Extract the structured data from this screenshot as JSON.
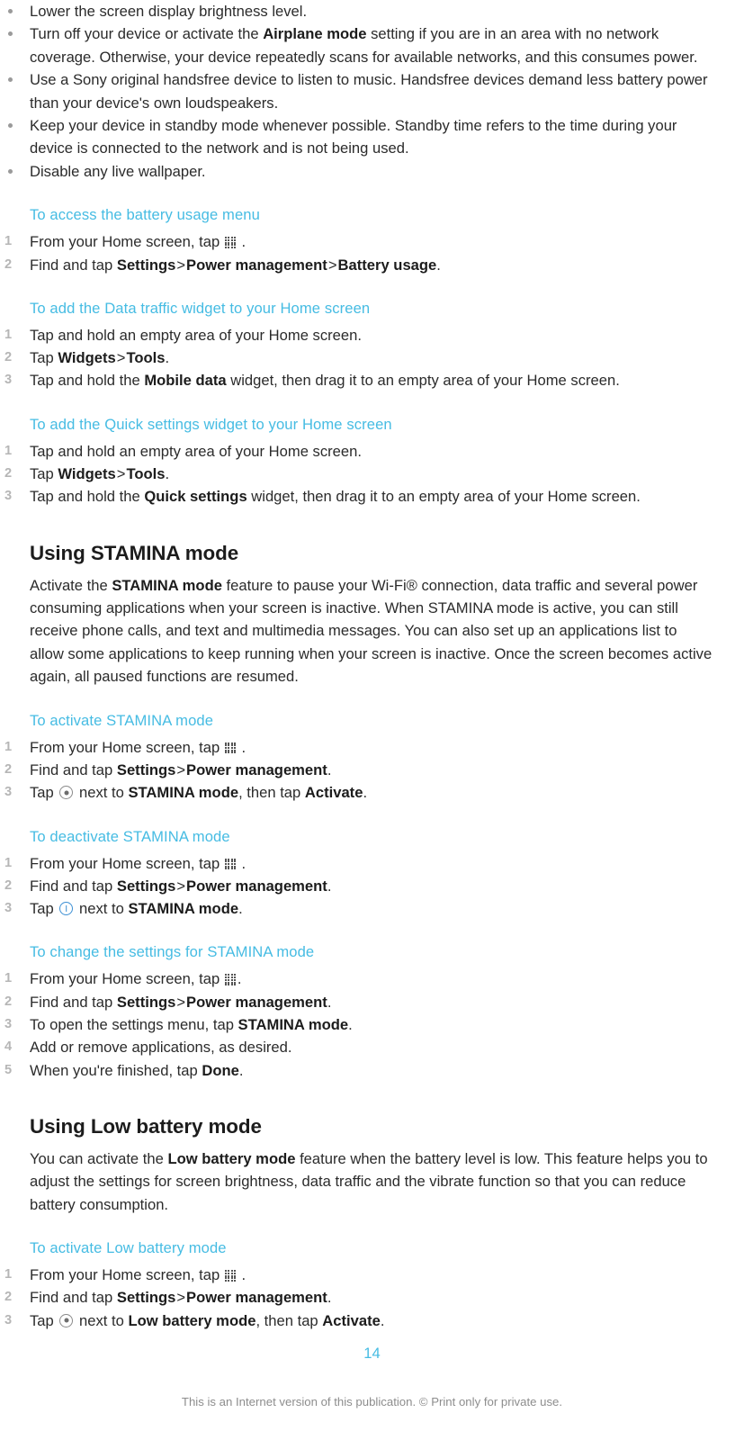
{
  "document": {
    "page_number": "14",
    "footer_note": "This is an Internet version of this publication. © Print only for private use.",
    "heading_color": "#46BCE3"
  },
  "battery_tips": {
    "items": [
      {
        "prefix": "Lower the screen display brightness level.",
        "bold": "",
        "suffix": ""
      },
      {
        "prefix": "Turn off your device or activate the ",
        "bold": "Airplane mode",
        "suffix": " setting if you are in an area with no network coverage. Otherwise, your device repeatedly scans for available networks, and this consumes power."
      },
      {
        "prefix": "Use a Sony original handsfree device to listen to music. Handsfree devices demand less battery power than your device's own loudspeakers.",
        "bold": "",
        "suffix": ""
      },
      {
        "prefix": "Keep your device in standby mode whenever possible. Standby time refers to the time during your device is connected to the network and is not being used.",
        "bold": "",
        "suffix": ""
      },
      {
        "prefix": "Disable any live wallpaper.",
        "bold": "",
        "suffix": ""
      }
    ]
  },
  "proc_battery_usage": {
    "heading": "To access the battery usage menu",
    "step1_before": "From your Home screen, tap",
    "step1_after": ".",
    "step2_a": "Find and tap ",
    "step2_b": "Settings",
    "step2_gt1": ">",
    "step2_c": "Power management",
    "step2_gt2": ">",
    "step2_d": "Battery usage",
    "step2_e": "."
  },
  "proc_data_widget": {
    "heading": "To add the Data traffic widget to your Home screen",
    "step1": "Tap and hold an empty area of your Home screen.",
    "step2_a": "Tap ",
    "step2_b": "Widgets",
    "step2_gt": ">",
    "step2_c": "Tools",
    "step2_d": ".",
    "step3_a": "Tap and hold the ",
    "step3_b": "Mobile data",
    "step3_c": " widget, then drag it to an empty area of your Home screen."
  },
  "proc_quick_settings_widget": {
    "heading": "To add the Quick settings widget to your Home screen",
    "step1": "Tap and hold an empty area of your Home screen.",
    "step2_a": "Tap ",
    "step2_b": "Widgets",
    "step2_gt": ">",
    "step2_c": "Tools",
    "step2_d": ".",
    "step3_a": "Tap and hold the ",
    "step3_b": "Quick settings",
    "step3_c": " widget, then drag it to an empty area of your Home screen."
  },
  "section_stamina": {
    "heading": "Using STAMINA mode",
    "para_a": "Activate the ",
    "para_b": "STAMINA mode",
    "para_c": " feature to pause your Wi-Fi® connection, data traffic and several power consuming applications when your screen is inactive. When STAMINA mode is active, you can still receive phone calls, and text and multimedia messages. You can also set up an applications list to allow some applications to keep running when your screen is inactive. Once the screen becomes active again, all paused functions are resumed."
  },
  "proc_activate_stamina": {
    "heading": "To activate STAMINA mode",
    "step1_before": "From your Home screen, tap",
    "step1_after": ".",
    "step2_a": "Find and tap ",
    "step2_b": "Settings",
    "step2_gt": ">",
    "step2_c": "Power management",
    "step2_d": ".",
    "step3_a": "Tap",
    "step3_b": "next to ",
    "step3_c": "STAMINA mode",
    "step3_d": ", then tap ",
    "step3_e": "Activate",
    "step3_f": "."
  },
  "proc_deactivate_stamina": {
    "heading": "To deactivate STAMINA mode",
    "step1_before": "From your Home screen, tap",
    "step1_after": ".",
    "step2_a": "Find and tap ",
    "step2_b": "Settings",
    "step2_gt": ">",
    "step2_c": "Power management",
    "step2_d": ".",
    "step3_a": "Tap",
    "step3_b": "next to ",
    "step3_c": "STAMINA mode",
    "step3_d": "."
  },
  "proc_change_stamina_settings": {
    "heading": "To change the settings for STAMINA mode",
    "step1_before": "From your Home screen, tap",
    "step1_after": ".",
    "step2_a": "Find and tap ",
    "step2_b": "Settings",
    "step2_gt": ">",
    "step2_c": "Power management",
    "step2_d": ".",
    "step3_a": "To open the settings menu, tap ",
    "step3_b": "STAMINA mode",
    "step3_c": ".",
    "step4": "Add or remove applications, as desired.",
    "step5_a": "When you're finished, tap ",
    "step5_b": "Done",
    "step5_c": "."
  },
  "section_low_battery": {
    "heading": "Using Low battery mode",
    "para_a": "You can activate the ",
    "para_b": "Low battery mode",
    "para_c": " feature when the battery level is low. This feature helps you to adjust the settings for screen brightness, data traffic and the vibrate function so that you can reduce battery consumption."
  },
  "proc_activate_low_battery": {
    "heading": "To activate Low battery mode",
    "step1_before": "From your Home screen, tap",
    "step1_after": ".",
    "step2_a": "Find and tap ",
    "step2_b": "Settings",
    "step2_gt": ">",
    "step2_c": "Power management",
    "step2_d": ".",
    "step3_a": "Tap",
    "step3_b": "next to ",
    "step3_c": "Low battery mode",
    "step3_d": ", then tap ",
    "step3_e": "Activate",
    "step3_f": "."
  },
  "icons": {
    "app_grid": "app-grid-icon",
    "radio": "radio-button-icon",
    "power_on": "power-on-toggle-icon"
  }
}
